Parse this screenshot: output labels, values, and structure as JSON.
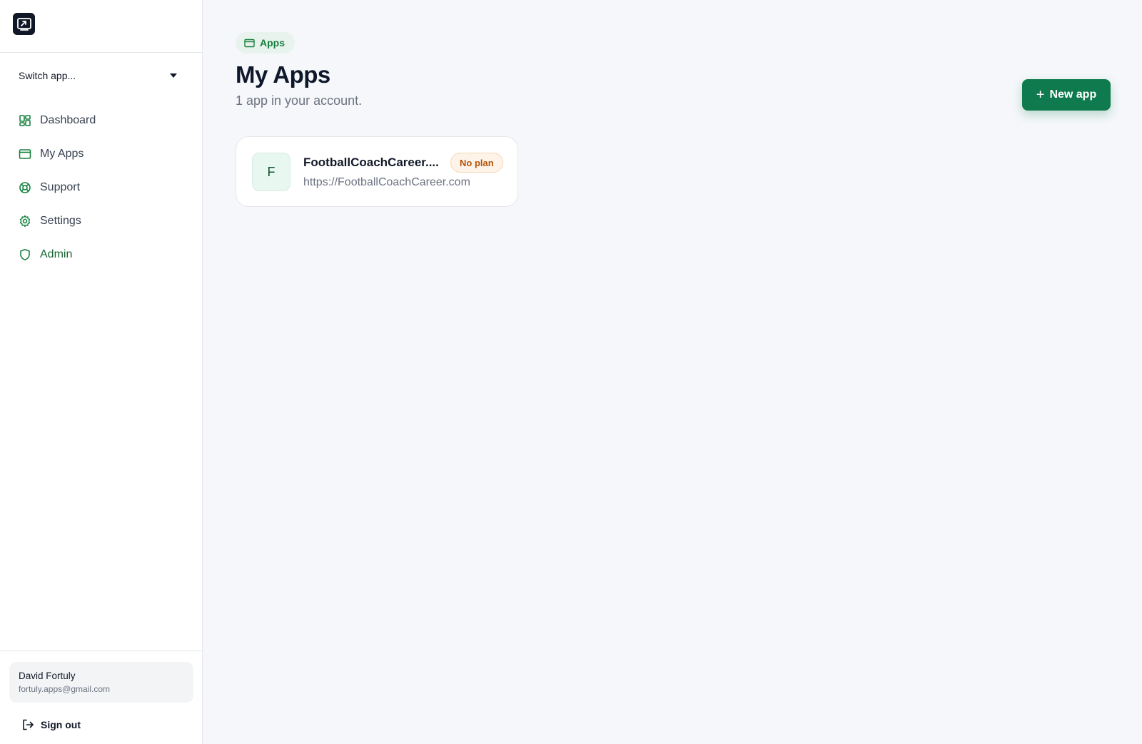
{
  "sidebar": {
    "switcher_label": "Switch app...",
    "nav": [
      {
        "label": "Dashboard",
        "icon": "dashboard-icon"
      },
      {
        "label": "My Apps",
        "icon": "window-icon"
      },
      {
        "label": "Support",
        "icon": "lifebuoy-icon"
      },
      {
        "label": "Settings",
        "icon": "gear-icon"
      },
      {
        "label": "Admin",
        "icon": "shield-icon"
      }
    ],
    "user": {
      "name": "David Fortuly",
      "email": "fortuly.apps@gmail.com"
    },
    "signout_label": "Sign out"
  },
  "main": {
    "breadcrumb": "Apps",
    "title": "My Apps",
    "subtitle": "1 app in your account.",
    "new_button": "New app",
    "new_button_icon": "+",
    "apps": [
      {
        "initial": "F",
        "name": "FootballCoachCareer....",
        "badge": "No plan",
        "url": "https://FootballCoachCareer.com"
      }
    ]
  },
  "colors": {
    "accent": "#0f7a4d",
    "admin_text": "#166534",
    "badge_text": "#b45309",
    "background": "#f5f7fa"
  }
}
